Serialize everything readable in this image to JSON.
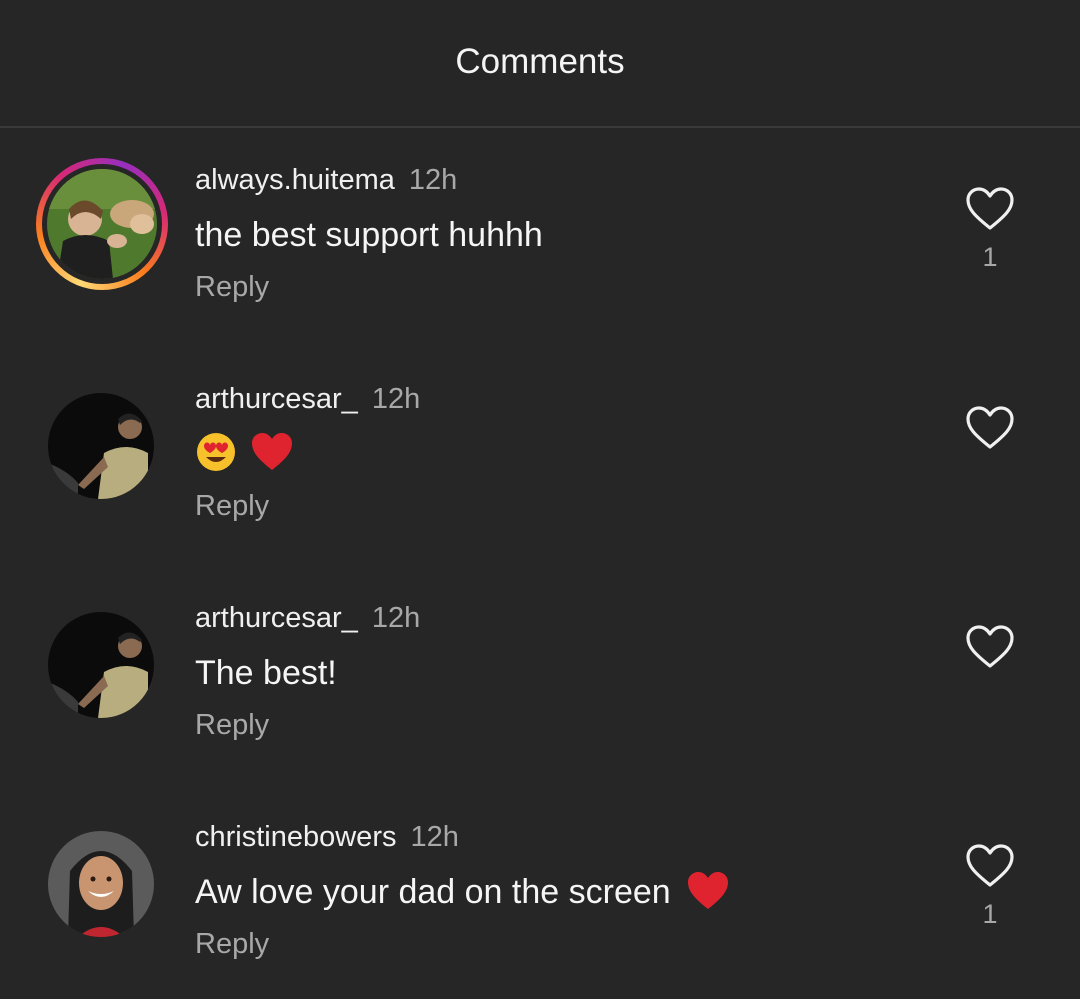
{
  "header": {
    "title": "Comments"
  },
  "comments": [
    {
      "username": "always.huitema",
      "time": "12h",
      "text": "the best support huhhh",
      "reply_label": "Reply",
      "likes": "1",
      "has_story": true
    },
    {
      "username": "arthurcesar_",
      "time": "12h",
      "text": "",
      "emojis": [
        "heart-eyes-emoji",
        "red-heart-emoji"
      ],
      "reply_label": "Reply",
      "likes": ""
    },
    {
      "username": "arthurcesar_",
      "time": "12h",
      "text": "The best!",
      "reply_label": "Reply",
      "likes": ""
    },
    {
      "username": "christinebowers",
      "time": "12h",
      "text": "Aw love your dad on the screen",
      "trailing_emoji": "red-heart-emoji",
      "reply_label": "Reply",
      "likes": "1"
    }
  ],
  "colors": {
    "background": "#262626",
    "text_primary": "#f5f5f5",
    "text_secondary": "#a8a8a8",
    "divider": "#3a3a3a",
    "heart_emoji": "#e0242f"
  }
}
